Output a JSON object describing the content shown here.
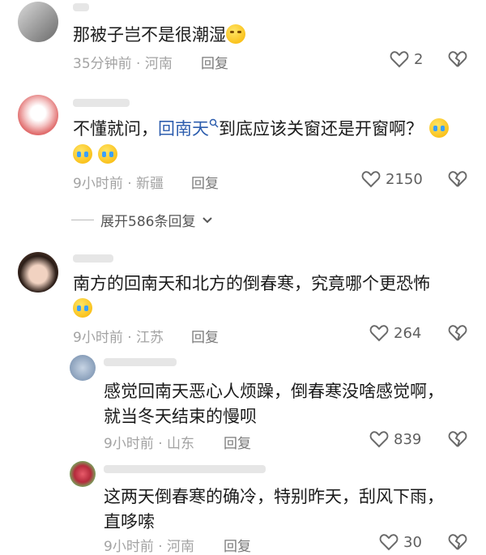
{
  "comments": [
    {
      "text": "那被子岂不是很潮湿",
      "time_location": "35分钟前 · 河南",
      "reply_label": "回复",
      "likes": "2",
      "emoji": "sweat-face"
    },
    {
      "text_before_link": "不懂就问，",
      "link_text": "回南天",
      "text_after_link": "到底应该关窗还是开窗啊？",
      "time_location": "9小时前 · 新疆",
      "reply_label": "回复",
      "likes": "2150",
      "emoji": "crying-face"
    },
    {
      "expand_label": "展开586条回复"
    },
    {
      "text": "南方的回南天和北方的倒春寒，究竟哪个更恐怖",
      "time_location": "9小时前 · 江苏",
      "reply_label": "回复",
      "likes": "264",
      "emoji": "laughing-crying-face"
    },
    {
      "text_line1": "感觉回南天恶心人烦躁，倒春寒没啥感觉啊，",
      "text_line2": "就当冬天结束的慢呗",
      "time_location": "9小时前 · 山东",
      "reply_label": "回复",
      "likes": "839"
    },
    {
      "text_line1": "这两天倒春寒的确冷，特别昨天，刮风下雨，",
      "text_line2": "直哆嗦",
      "time_location": "9小时前 · 河南",
      "reply_label": "回复",
      "likes": "30"
    }
  ],
  "colors": {
    "link": "#2e5eae",
    "meta": "#a3a3a3",
    "text": "#1b1b1b"
  },
  "icons": [
    "heart-icon",
    "broken-heart-icon",
    "search-mini-icon",
    "chevron-down-icon"
  ]
}
